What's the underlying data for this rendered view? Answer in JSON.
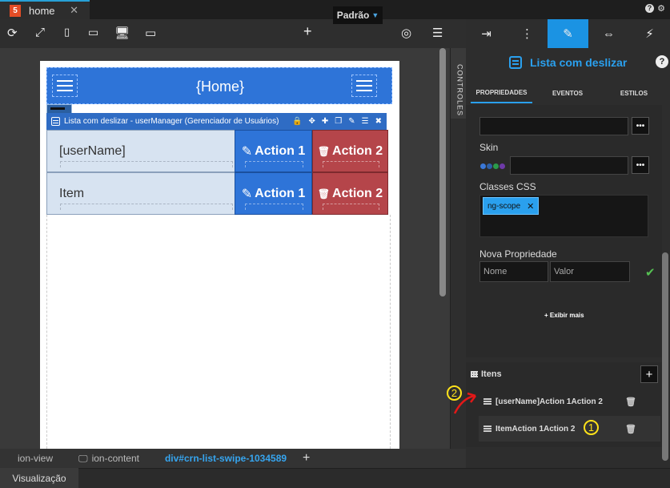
{
  "file_tab": {
    "label": "home",
    "close": "✕"
  },
  "toolbar": {
    "device": "Padrão"
  },
  "canvas": {
    "header_title": "{Home}",
    "component_bar": "Lista com deslizar - userManager (Gerenciador de Usuários)",
    "rows": [
      {
        "text": "[userName]",
        "action1": "Action 1",
        "action2": "Action 2"
      },
      {
        "text": "Item",
        "action1": "Action 1",
        "action2": "Action 2"
      }
    ]
  },
  "controls_label": "CONTROLES",
  "breadcrumb": [
    "ion-view",
    "ion-content",
    "div#crn-list-swipe-1034589"
  ],
  "bottom_tab": "Visualização",
  "panel": {
    "component_title": "Lista com deslizar",
    "tabs": [
      "PROPRIEDADES",
      "EVENTOS",
      "ESTILOS"
    ],
    "skin_label": "Skin",
    "css_label": "Classes CSS",
    "css_chip": "ng-scope",
    "new_prop_label": "Nova Propriedade",
    "name_placeholder": "Nome",
    "value_placeholder": "Valor",
    "show_more": "+ Exibir mais",
    "items_title": "Itens",
    "items": [
      "[userName]Action 1Action 2",
      "ItemAction 1Action 2"
    ],
    "swatch_colors": [
      "#3a78d8",
      "#2d5fa8",
      "#2a9a4a",
      "#6e3aa8"
    ]
  },
  "annotations": {
    "a1": "1",
    "a2": "2",
    "color": "#ffe21a",
    "arrow_color": "#e21818"
  }
}
